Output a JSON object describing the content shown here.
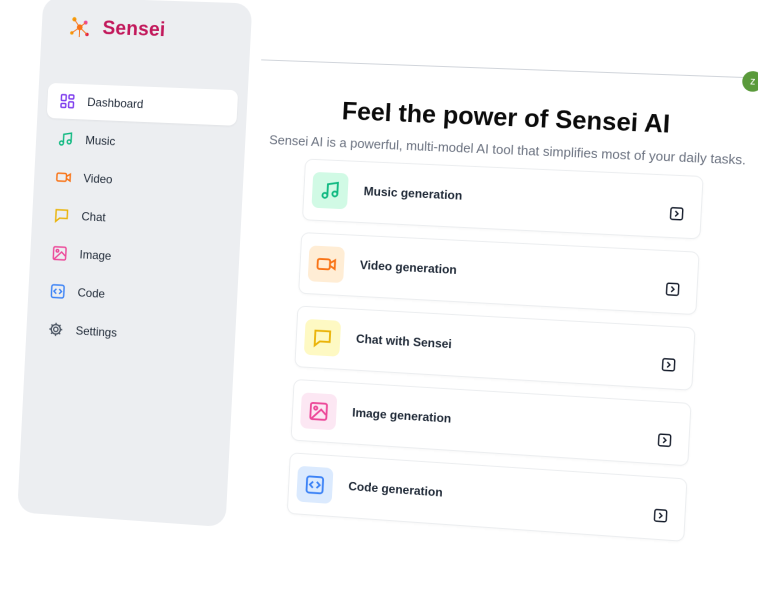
{
  "app": {
    "name": "Sensei"
  },
  "colors": {
    "brand": "#c2185b",
    "avatar": "#5a9a3b",
    "dashboard": "#7c3aed",
    "music": "#10b981",
    "video": "#f97316",
    "chat": "#eab308",
    "image": "#ec4899",
    "code": "#3b82f6",
    "settings": "#4b5563"
  },
  "sidebar": {
    "items": [
      {
        "label": "Dashboard",
        "icon": "grid-icon"
      },
      {
        "label": "Music",
        "icon": "music-icon"
      },
      {
        "label": "Video",
        "icon": "video-icon"
      },
      {
        "label": "Chat",
        "icon": "chat-icon"
      },
      {
        "label": "Image",
        "icon": "image-icon"
      },
      {
        "label": "Code",
        "icon": "code-icon"
      },
      {
        "label": "Settings",
        "icon": "gear-icon"
      }
    ]
  },
  "user": {
    "initial": "z"
  },
  "main": {
    "title": "Feel the power of Sensei AI",
    "subtitle": "Sensei AI is a powerful, multi-model AI tool that simplifies most of your daily tasks.",
    "cards": [
      {
        "label": "Music generation",
        "icon": "music-icon"
      },
      {
        "label": "Video generation",
        "icon": "video-icon"
      },
      {
        "label": "Chat with Sensei",
        "icon": "chat-icon"
      },
      {
        "label": "Image generation",
        "icon": "image-icon"
      },
      {
        "label": "Code generation",
        "icon": "code-icon"
      }
    ]
  }
}
